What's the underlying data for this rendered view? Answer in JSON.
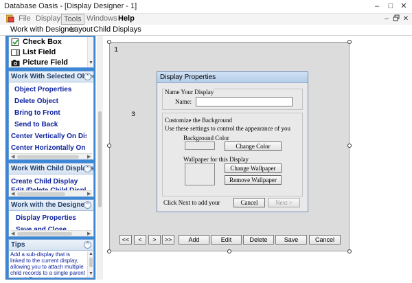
{
  "window": {
    "title": "Database Oasis - [Display Designer - 1]",
    "controls": {
      "minimize": "–",
      "maximize": "□",
      "close": "✕"
    }
  },
  "menubar": {
    "items": [
      "File",
      "Displays",
      "Tools",
      "Windows",
      "Help"
    ],
    "active": "Tools",
    "child_controls": {
      "minimize": "–",
      "restore": "3",
      "close": "✕"
    }
  },
  "submenu": {
    "items": [
      "Work with Designer",
      "Layout",
      "Child Displays"
    ]
  },
  "fields_pane": {
    "items": [
      {
        "label": "Check Box",
        "icon": "checkbox-icon"
      },
      {
        "label": "List Field",
        "icon": "list-field-icon"
      },
      {
        "label": "Picture Field",
        "icon": "camera-icon"
      }
    ]
  },
  "selected_objects_pane": {
    "title": "Work With Selected Objec",
    "links": [
      "Object Properties",
      "Delete Object",
      "Bring to Front",
      "Send to Back",
      "Center Vertically On Display",
      "Center Horizontally On Display"
    ]
  },
  "child_displays_pane": {
    "title": "Work With Child Displays",
    "links": [
      "Create Child Display",
      "Edit /Delete Child Display"
    ]
  },
  "designer_pane": {
    "title": "Work with the Designer",
    "links": [
      "Display Properties",
      "Save and Close"
    ]
  },
  "tips_pane": {
    "title": "Tips",
    "text": "Add a sub-display that is linked to the current display, allowing you to attach multiple child records to a single parent record. For example,"
  },
  "canvas": {
    "label_1": "1",
    "label_3": "3"
  },
  "dialog": {
    "title": "Display Properties",
    "name_group": "Name Your Display",
    "name_label": "Name:",
    "name_value": "",
    "bg_group": "Customize the Background",
    "bg_hint": "Use these settings to control the appearance of you",
    "bg_color_label": "Background Color",
    "change_color": "Change Color",
    "wallpaper_label": "Wallpaper for this Display",
    "change_wallpaper": "Change Wallpaper",
    "remove_wallpaper": "Remove Wallpaper",
    "footer_text": "Click Next to add your",
    "cancel": "Cancel",
    "next": "Next >"
  },
  "nav": {
    "first": "<<",
    "prev": "<",
    "next": ">",
    "last": ">>",
    "add": "Add",
    "edit": "Edit",
    "delete": "Delete",
    "save": "Save",
    "cancel": "Cancel"
  }
}
